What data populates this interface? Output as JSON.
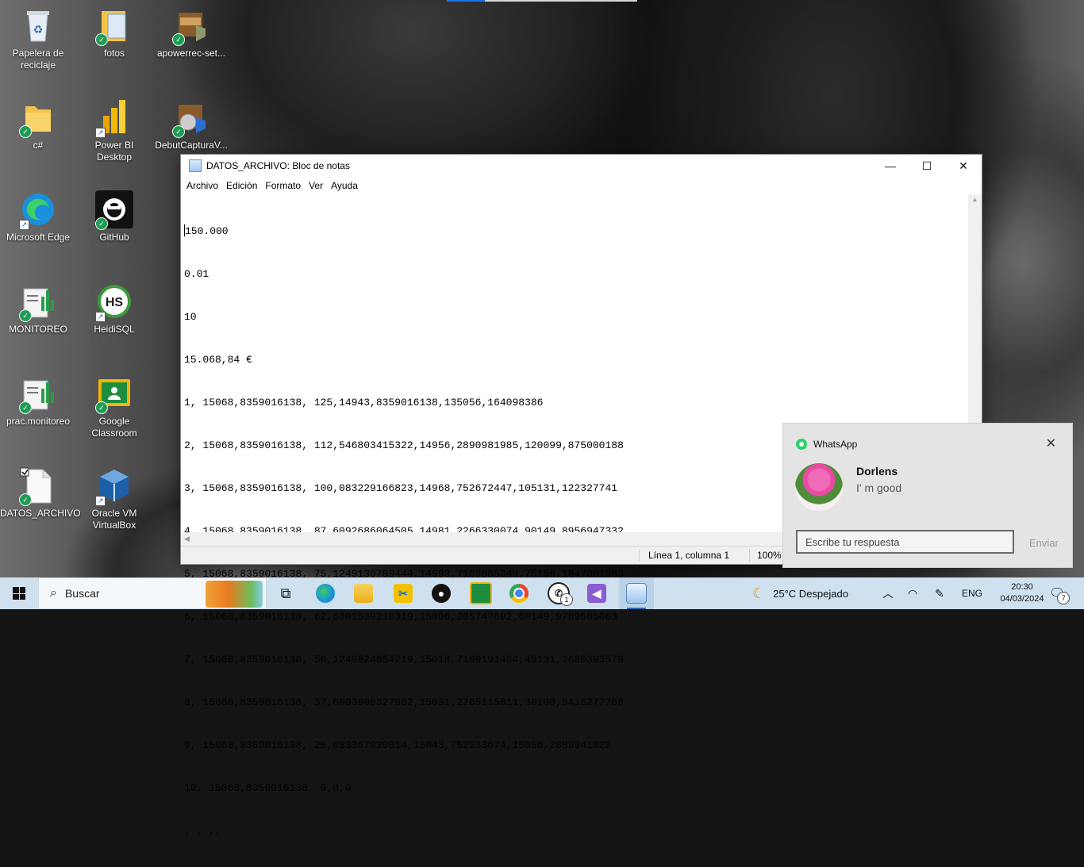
{
  "desktop": {
    "icons": [
      {
        "label": "Papelera de reciclaje",
        "icon": "recycle-bin-icon"
      },
      {
        "label": "fotos",
        "icon": "folder-icon"
      },
      {
        "label": "apowerrec-set...",
        "icon": "installer-icon"
      },
      {
        "label": "c#",
        "icon": "folder-icon"
      },
      {
        "label": "Power BI Desktop",
        "icon": "powerbi-icon"
      },
      {
        "label": "DebutCapturaV...",
        "icon": "installer-icon"
      },
      {
        "label": "Microsoft Edge",
        "icon": "edge-icon"
      },
      {
        "label": "GitHub",
        "icon": "github-icon"
      },
      {
        "label": "MONITOREO",
        "icon": "document-chart-icon"
      },
      {
        "label": "HeidiSQL",
        "icon": "heidisql-icon"
      },
      {
        "label": "prac.monitoreo",
        "icon": "document-chart-icon"
      },
      {
        "label": "Google Classroom",
        "icon": "classroom-icon"
      },
      {
        "label": "DATOS_ARCHIVO",
        "icon": "text-file-icon"
      },
      {
        "label": "Oracle VM VirtualBox",
        "icon": "virtualbox-icon"
      }
    ],
    "heidisql_short": "HS"
  },
  "notepad": {
    "title": "DATOS_ARCHIVO: Bloc de notas",
    "menu": [
      "Archivo",
      "Edición",
      "Formato",
      "Ver",
      "Ayuda"
    ],
    "lines": [
      "150.000",
      "0.01",
      "10",
      "15.068,84 €",
      "1, 15068,8359016138, 125,14943,8359016138,135056,164098386",
      "2, 15068,8359016138, 112,546803415322,14956,2890981985,120099,875000188",
      "3, 15068,8359016138, 100,083229166823,14968,752672447,105131,122327741",
      "4, 15068,8359016138, 87,6092686064505,14981,2266330074,90149,8956947332",
      "5, 15068,8359016138, 75,1249130789444,14993,7109885349,75156,1847061983",
      "6, 15068,8359016138, 62,6301539218319,15006,205747692,60149,9789585063",
      "7, 15068,8359016138, 50,1249824654219,15018,7109191484,45131,2680393579",
      "8, 15068,8359016138, 37,6093900327982,15031,2265115811,30100,0415277768",
      "9, 15068,8359016138, 25,083367939814,15043,752533674,15056,2889941028",
      "10, 15068,8359016138, 0,0,0",
      ", , ,,"
    ],
    "status": {
      "position": "Línea 1, columna 1",
      "zoom": "100%"
    }
  },
  "toast": {
    "app": "WhatsApp",
    "sender": "Dorlens",
    "message": "I' m good",
    "reply_placeholder": "Escribe tu respuesta",
    "send_label": "Enviar"
  },
  "taskbar": {
    "search_label": "Buscar",
    "whatsapp_badge": "1",
    "weather": "25°C  Despejado",
    "language": "ENG",
    "time": "20:30",
    "date": "04/03/2024",
    "notifications_count": "7"
  },
  "colors": {
    "taskbar": "#cfe1ef",
    "whatsapp": "#25d366",
    "accent": "#1a73e8"
  }
}
